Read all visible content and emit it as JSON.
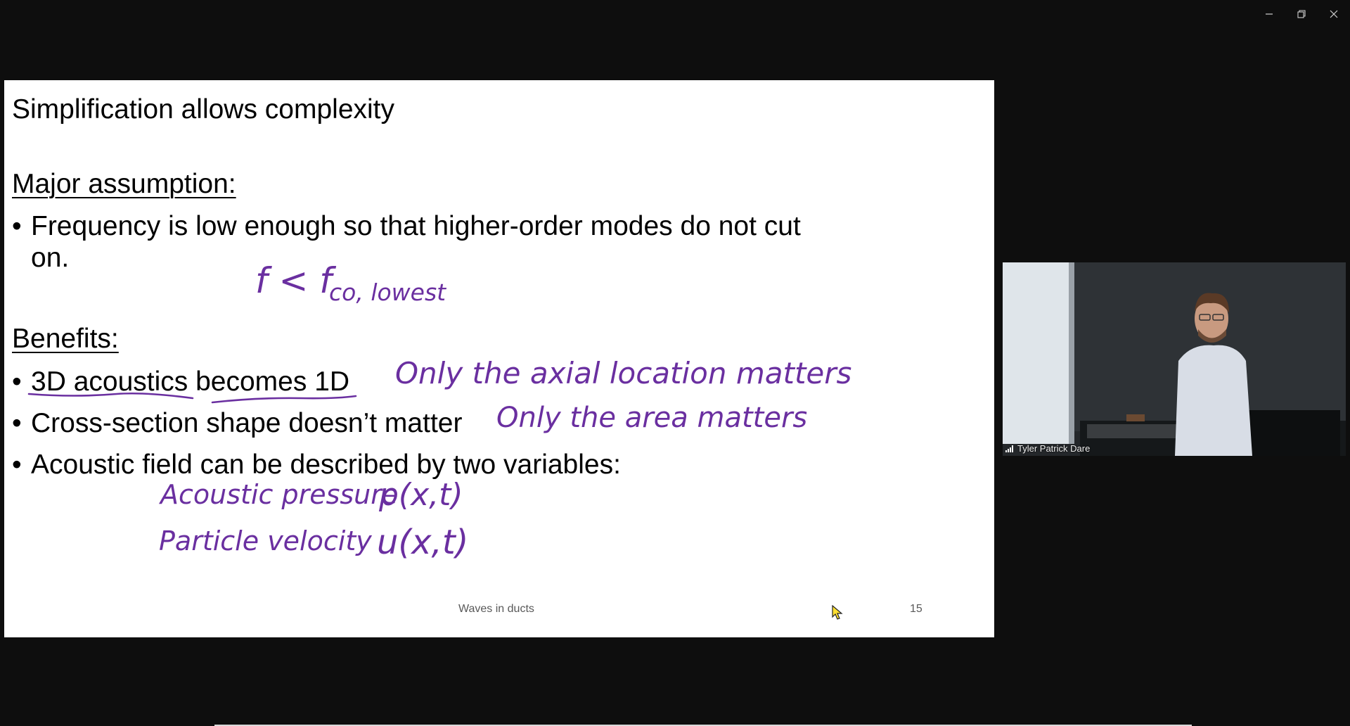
{
  "window": {
    "minimize_icon": "minimize-icon",
    "restore_icon": "restore-icon",
    "close_icon": "close-icon"
  },
  "slide": {
    "title": "Simplification allows complexity",
    "major_heading": "Major assumption:",
    "bullet_frequency_line1": "Frequency is low enough so that higher-order modes do not cut",
    "bullet_frequency_line2": "on.",
    "benefits_heading": "Benefits:",
    "bullet_3d_part1": "3D acoustics",
    "bullet_3d_part2": "becomes 1D",
    "bullet_cross_section": "Cross-section shape doesn’t matter",
    "bullet_acoustic_field": "Acoustic field can be described by two variables:",
    "footer_title": "Waves in ducts",
    "page_number": "15",
    "bullet_symbol": "•"
  },
  "annotations": {
    "freq_condition_main": "f < f",
    "freq_condition_sub": "co, lowest",
    "axial_note": "Only the axial location matters",
    "area_note": "Only the area matters",
    "pressure_label": "Acoustic pressure",
    "pressure_symbol": "p(x,t)",
    "velocity_label": "Particle velocity",
    "velocity_symbol": "u(x,t)",
    "ink_color": "#6a2fa0"
  },
  "video": {
    "participant_name": "Tyler Patrick Dare",
    "signal_icon": "signal-bars-icon"
  }
}
